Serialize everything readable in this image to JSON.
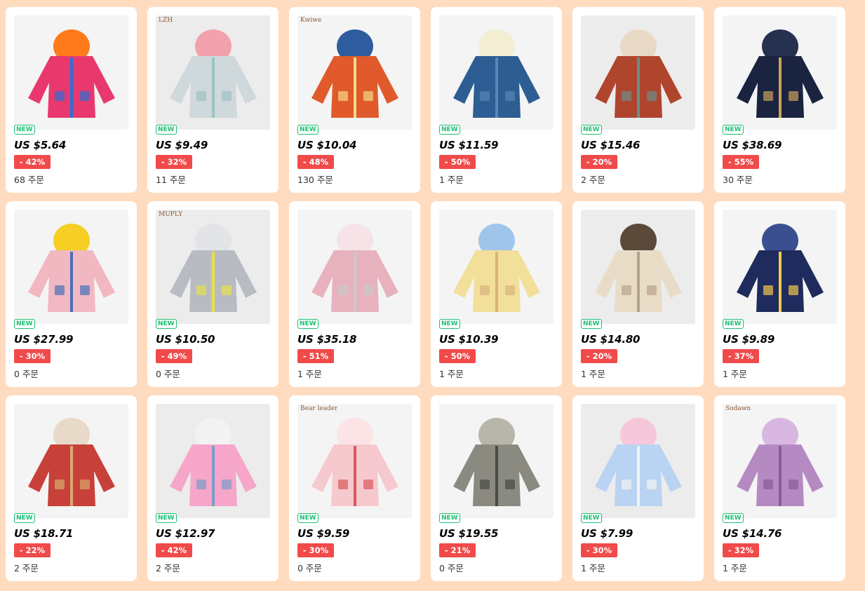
{
  "products": [
    {
      "badge": "NEW",
      "price": "US $5.64",
      "discount": "- 42%",
      "orders": "68 주문",
      "colors": [
        "#e8386e",
        "#ff7a1a",
        "#2e6fd6"
      ],
      "brand": ""
    },
    {
      "badge": "NEW",
      "price": "US $9.49",
      "discount": "- 32%",
      "orders": "11 주문",
      "colors": [
        "#cfd8da",
        "#f2a1ad",
        "#9cc3c4"
      ],
      "brand": "LZH"
    },
    {
      "badge": "NEW",
      "price": "US $10.04",
      "discount": "- 48%",
      "orders": "130 주문",
      "colors": [
        "#e05a2b",
        "#2e5c9e",
        "#f2d98a"
      ],
      "brand": "Kwiwe"
    },
    {
      "badge": "NEW",
      "price": "US $11.59",
      "discount": "- 50%",
      "orders": "1 주문",
      "colors": [
        "#2d5d93",
        "#f3eed3",
        "#5a86b5"
      ],
      "brand": ""
    },
    {
      "badge": "NEW",
      "price": "US $15.46",
      "discount": "- 20%",
      "orders": "2 주문",
      "colors": [
        "#b0452e",
        "#e8d9c7",
        "#6b8f8a"
      ],
      "brand": ""
    },
    {
      "badge": "NEW",
      "price": "US $38.69",
      "discount": "- 55%",
      "orders": "30 주문",
      "colors": [
        "#1a2340",
        "#26304f",
        "#c9a35a"
      ],
      "brand": ""
    },
    {
      "badge": "NEW",
      "price": "US $27.99",
      "discount": "- 30%",
      "orders": "0 주문",
      "colors": [
        "#f2b8c2",
        "#f5cf23",
        "#4a6fb5"
      ],
      "brand": ""
    },
    {
      "badge": "NEW",
      "price": "US $10.50",
      "discount": "- 49%",
      "orders": "0 주문",
      "colors": [
        "#b8bcc2",
        "#e2e4e8",
        "#e8e04a"
      ],
      "brand": "MUPLY"
    },
    {
      "badge": "NEW",
      "price": "US $35.18",
      "discount": "- 51%",
      "orders": "1 주문",
      "colors": [
        "#e7b2be",
        "#f5e3e8",
        "#c9c9c9"
      ],
      "brand": ""
    },
    {
      "badge": "NEW",
      "price": "US $10.39",
      "discount": "- 50%",
      "orders": "1 주문",
      "colors": [
        "#f2df9a",
        "#9fc6ea",
        "#d9b27c"
      ],
      "brand": ""
    },
    {
      "badge": "NEW",
      "price": "US $14.80",
      "discount": "- 20%",
      "orders": "1 주문",
      "colors": [
        "#e8dcc7",
        "#5b4a3a",
        "#b8a38a"
      ],
      "brand": ""
    },
    {
      "badge": "NEW",
      "price": "US $9.89",
      "discount": "- 37%",
      "orders": "1 주문",
      "colors": [
        "#1e2b5c",
        "#3a4f8f",
        "#f2c94c"
      ],
      "brand": ""
    },
    {
      "badge": "NEW",
      "price": "US $18.71",
      "discount": "- 22%",
      "orders": "2 주문",
      "colors": [
        "#c8403a",
        "#e8dac8",
        "#d9a96b"
      ],
      "brand": ""
    },
    {
      "badge": "NEW",
      "price": "US $12.97",
      "discount": "- 42%",
      "orders": "2 주문",
      "colors": [
        "#f6a6c8",
        "#f2f2f2",
        "#7a9bc9"
      ],
      "brand": ""
    },
    {
      "badge": "NEW",
      "price": "US $9.59",
      "discount": "- 30%",
      "orders": "0 주문",
      "colors": [
        "#f6c9cf",
        "#fbe3e6",
        "#d95a5a"
      ],
      "brand": "Bear leader"
    },
    {
      "badge": "NEW",
      "price": "US $19.55",
      "discount": "- 21%",
      "orders": "0 주문",
      "colors": [
        "#8a8a80",
        "#b8b6aa",
        "#4a4a44"
      ],
      "brand": ""
    },
    {
      "badge": "NEW",
      "price": "US $7.99",
      "discount": "- 30%",
      "orders": "1 주문",
      "colors": [
        "#b9d3f2",
        "#f6c7da",
        "#f2f2f2"
      ],
      "brand": ""
    },
    {
      "badge": "NEW",
      "price": "US $14.76",
      "discount": "- 32%",
      "orders": "1 주문",
      "colors": [
        "#b58ac2",
        "#d8b8e0",
        "#8a5a9a"
      ],
      "brand": "Sodawn"
    }
  ]
}
